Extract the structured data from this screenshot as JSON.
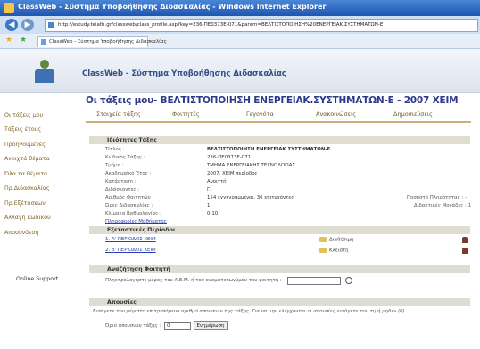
{
  "window": {
    "title": "ClassWeb - Σύστημα Υποβοήθησης Διδασκαλίας - Windows Internet Explorer"
  },
  "browser": {
    "url": "http://estudy.teiath.gr/classweb/class_profile.asp?key=236-ΠΕ0373Ε-071&param=ΒΕΛΤΙΣΤΟΠΟΙΗΣΗ%20ΕΝΕΡΓΕΙΑΚ.ΣΥΣΤΗΜΑΤΩΝ-Ε",
    "tab_label": "ClassWeb - Σύστημα Υποβοήθησης Διδασκαλίας"
  },
  "app": {
    "title": "ClassWeb - Σύστημα Υποβοήθησης Διδασκαλίας"
  },
  "course": {
    "heading": "Οι τάξεις μου- ΒΕΛΤΙΣΤΟΠΟΙΗΣΗ ΕΝΕΡΓΕΙΑΚ.ΣΥΣΤΗΜΑΤΩΝ-Ε - 2007 ΧΕΙΜ"
  },
  "subtabs": [
    "Στοιχεία τάξης",
    "Φοιτητές",
    "Γεγονότα",
    "Ανακοινώσεις",
    "Δημοσιεύσεις"
  ],
  "sidebar": {
    "items": [
      "Οι τάξεις μου",
      "Τάξεις έτους",
      "Προηγούμενες",
      "Ανοιχτά θέματα",
      "Όλα τα θέματα",
      "Πρ.Διδασκαλίας",
      "Πρ.Εξέτασεων",
      "Αλλαγή κωδικού",
      "Αποσύνδεση"
    ],
    "support": "Online Support"
  },
  "details": {
    "title": "Ιδιότητες Τάξης",
    "fields": [
      {
        "label": "Τίτλος :",
        "value": "ΒΕΛΤΙΣΤΟΠΟΙΗΣΗ ΕΝΕΡΓΕΙΑΚ.ΣΥΣΤΗΜΑΤΩΝ-Ε"
      },
      {
        "label": "Κωδικός Τάξης :",
        "value": "236-ΠΕ0373Ε-071"
      },
      {
        "label": "Τμήμα :",
        "value": "ΤΜΗΜΑ ΕΝΕΡΓΕΙΑΚΗΣ ΤΕΧΝΟΛΟΓΙΑΣ"
      },
      {
        "label": "Ακαδημαϊκό Έτος :",
        "value": "2007, ΧΕΙΜ περίοδος"
      },
      {
        "label": "Κατάσταση :",
        "value": "Ανοιχτή"
      },
      {
        "label": "Διδάσκοντες :",
        "value": "Γ."
      },
      {
        "label": "Αριθμός Φοιτητών :",
        "value": "154 εγγεγραμμένοι, 36 επιτυχόντες"
      },
      {
        "label": "Ώρες Διδασκαλίας :",
        "value": "1"
      },
      {
        "label": "Κλίμακα Βαθμολογίας :",
        "value": "0-10"
      }
    ],
    "right_labels": [
      "Ποσοστό Πληρότητας : -",
      "Διδακτικές Μονάδες : 1"
    ],
    "info_link": "Πληροφορίες Μαθήματος"
  },
  "exams": {
    "title": "Εξεταστικές Περίοδοι",
    "rows": [
      {
        "label": "1. Α' ΠΕΡΙΟΔΟΣ ΧΕΙΜ",
        "action": "Διαθέσιμη"
      },
      {
        "label": "2. Β' ΠΕΡΙΟΔΟΣ ΧΕΙΜ",
        "action": "Κλειστή"
      }
    ]
  },
  "search": {
    "title": "Αναζήτηση Φοιτητή",
    "label": "Πληκτρολογήστε μέρος του Α.Ε.Μ. ή του ονοματεπωνύμου του φοιτητή :"
  },
  "absences": {
    "title": "Απουσίες",
    "description": "Εισάγετε τον μέγιστο επιτρεπόμενο αριθμό απουσιών της τάξης. Για να μην ελέγχονται οι απουσίες εισάγετε τον τιμή μηδέν (0).",
    "limit_label": "Όριο απουσιών τάξης :",
    "limit_value": "0",
    "update_button": "Ενημέρωση"
  }
}
